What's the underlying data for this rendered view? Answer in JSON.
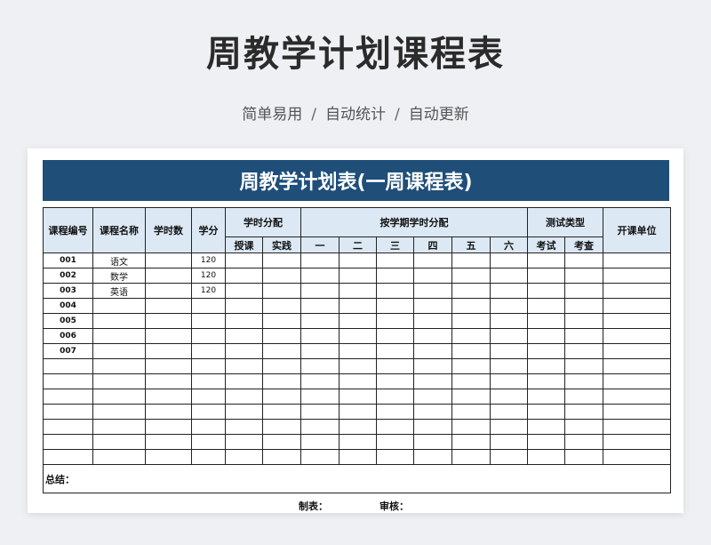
{
  "title": "周教学计划课程表",
  "subtitle": {
    "items": [
      "简单易用",
      "自动统计",
      "自动更新"
    ],
    "separator": "/"
  },
  "sheet": {
    "banner": "周教学计划表(一周课程表)",
    "headers": {
      "course_id": "课程编号",
      "course_name": "课程名称",
      "hours": "学时数",
      "credits": "学分",
      "hour_alloc": "学时分配",
      "teaching": "授课",
      "practice": "实践",
      "semester_alloc": "按学期学时分配",
      "semesters": [
        "一",
        "二",
        "三",
        "四",
        "五",
        "六"
      ],
      "test_type": "测试类型",
      "exam": "考试",
      "check": "考查",
      "dept": "开课单位"
    },
    "rows": [
      {
        "id": "001",
        "name": "语文",
        "credits": "120"
      },
      {
        "id": "002",
        "name": "数学",
        "credits": "120"
      },
      {
        "id": "003",
        "name": "英语",
        "credits": "120"
      },
      {
        "id": "004",
        "name": "",
        "credits": ""
      },
      {
        "id": "005",
        "name": "",
        "credits": ""
      },
      {
        "id": "006",
        "name": "",
        "credits": ""
      },
      {
        "id": "007",
        "name": "",
        "credits": ""
      },
      {
        "id": "",
        "name": "",
        "credits": ""
      },
      {
        "id": "",
        "name": "",
        "credits": ""
      },
      {
        "id": "",
        "name": "",
        "credits": ""
      },
      {
        "id": "",
        "name": "",
        "credits": ""
      },
      {
        "id": "",
        "name": "",
        "credits": ""
      },
      {
        "id": "",
        "name": "",
        "credits": ""
      },
      {
        "id": "",
        "name": "",
        "credits": ""
      }
    ],
    "summary_label": "总结：",
    "footer": {
      "maker": "制表：",
      "reviewer": "审核："
    }
  }
}
